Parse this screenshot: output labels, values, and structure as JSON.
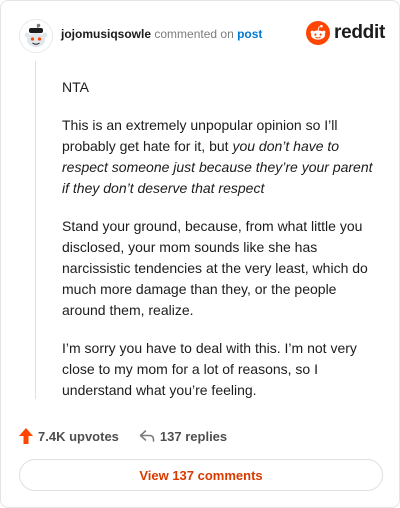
{
  "header": {
    "username": "jojomusiqsowle",
    "action_text": "commented on",
    "post_link": "post",
    "logo_text": "reddit",
    "avatar_icon": "snoo-avatar-icon",
    "logo_icon": "reddit-alien-icon"
  },
  "comment": {
    "p1": "NTA",
    "p2_plain": "This is an extremely unpopular opinion so I’ll probably get hate for it, but ",
    "p2_italic": "you don’t have to respect someone just because they’re your parent if they don’t deserve that respect",
    "p3": "Stand your ground, because, from what little you disclosed, your mom sounds like she has narcissistic tendencies at the very least, which do much more damage than they, or the people around them, realize.",
    "p4": "I’m sorry you have to deal with this. I’m not very close to my mom for a lot of reasons, so I understand what you’re feeling."
  },
  "actions": {
    "upvotes": "7.4K upvotes",
    "replies": "137 replies",
    "upvote_icon": "upvote-arrow-icon",
    "reply_icon": "reply-arrow-icon"
  },
  "footer": {
    "view_comments": "View 137 comments"
  },
  "colors": {
    "reddit_orange": "#ff4500",
    "link_blue": "#0079d3",
    "button_text": "#d93a00"
  }
}
